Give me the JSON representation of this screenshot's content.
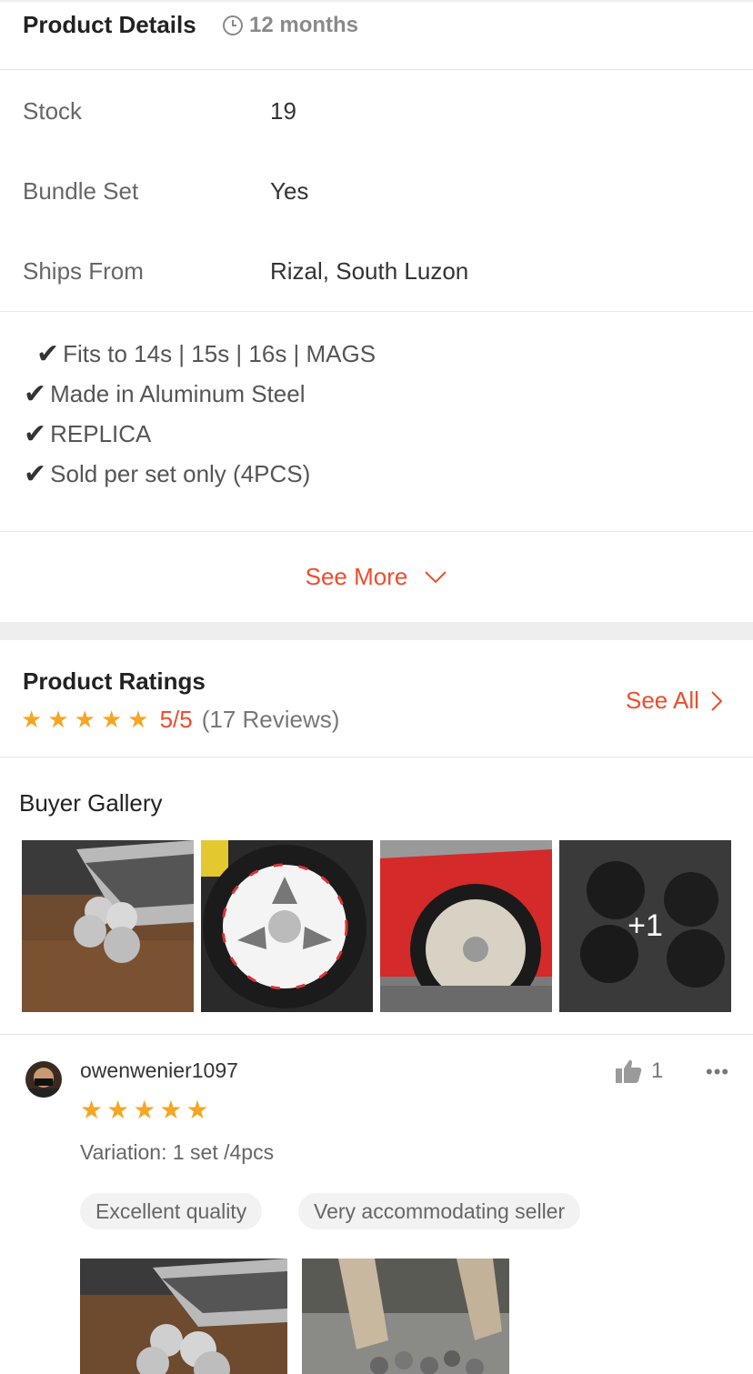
{
  "product_details": {
    "title": "Product Details",
    "duration": "12 months",
    "rows": [
      {
        "label": "Stock",
        "value": "19"
      },
      {
        "label": "Bundle Set",
        "value": "Yes"
      },
      {
        "label": "Ships From",
        "value": "Rizal, South Luzon"
      }
    ]
  },
  "description": {
    "lines": [
      "Fits to 14s | 15s | 16s |  MAGS",
      "Made in Aluminum Steel",
      "REPLICA",
      "Sold per set only (4PCS)"
    ],
    "see_more_label": "See More"
  },
  "ratings": {
    "title": "Product Ratings",
    "score": "5/5",
    "review_count": "(17 Reviews)",
    "stars": 5,
    "see_all_label": "See All"
  },
  "gallery": {
    "title": "Buyer Gallery",
    "more_count": "+1"
  },
  "review": {
    "username": "owenwenier1097",
    "stars": 5,
    "like_count": "1",
    "variation": "Variation: 1 set /4pcs",
    "tags": [
      "Excellent quality",
      "Very accommodating seller"
    ]
  },
  "colors": {
    "accent": "#ee4d2d",
    "star": "#f5a623"
  }
}
